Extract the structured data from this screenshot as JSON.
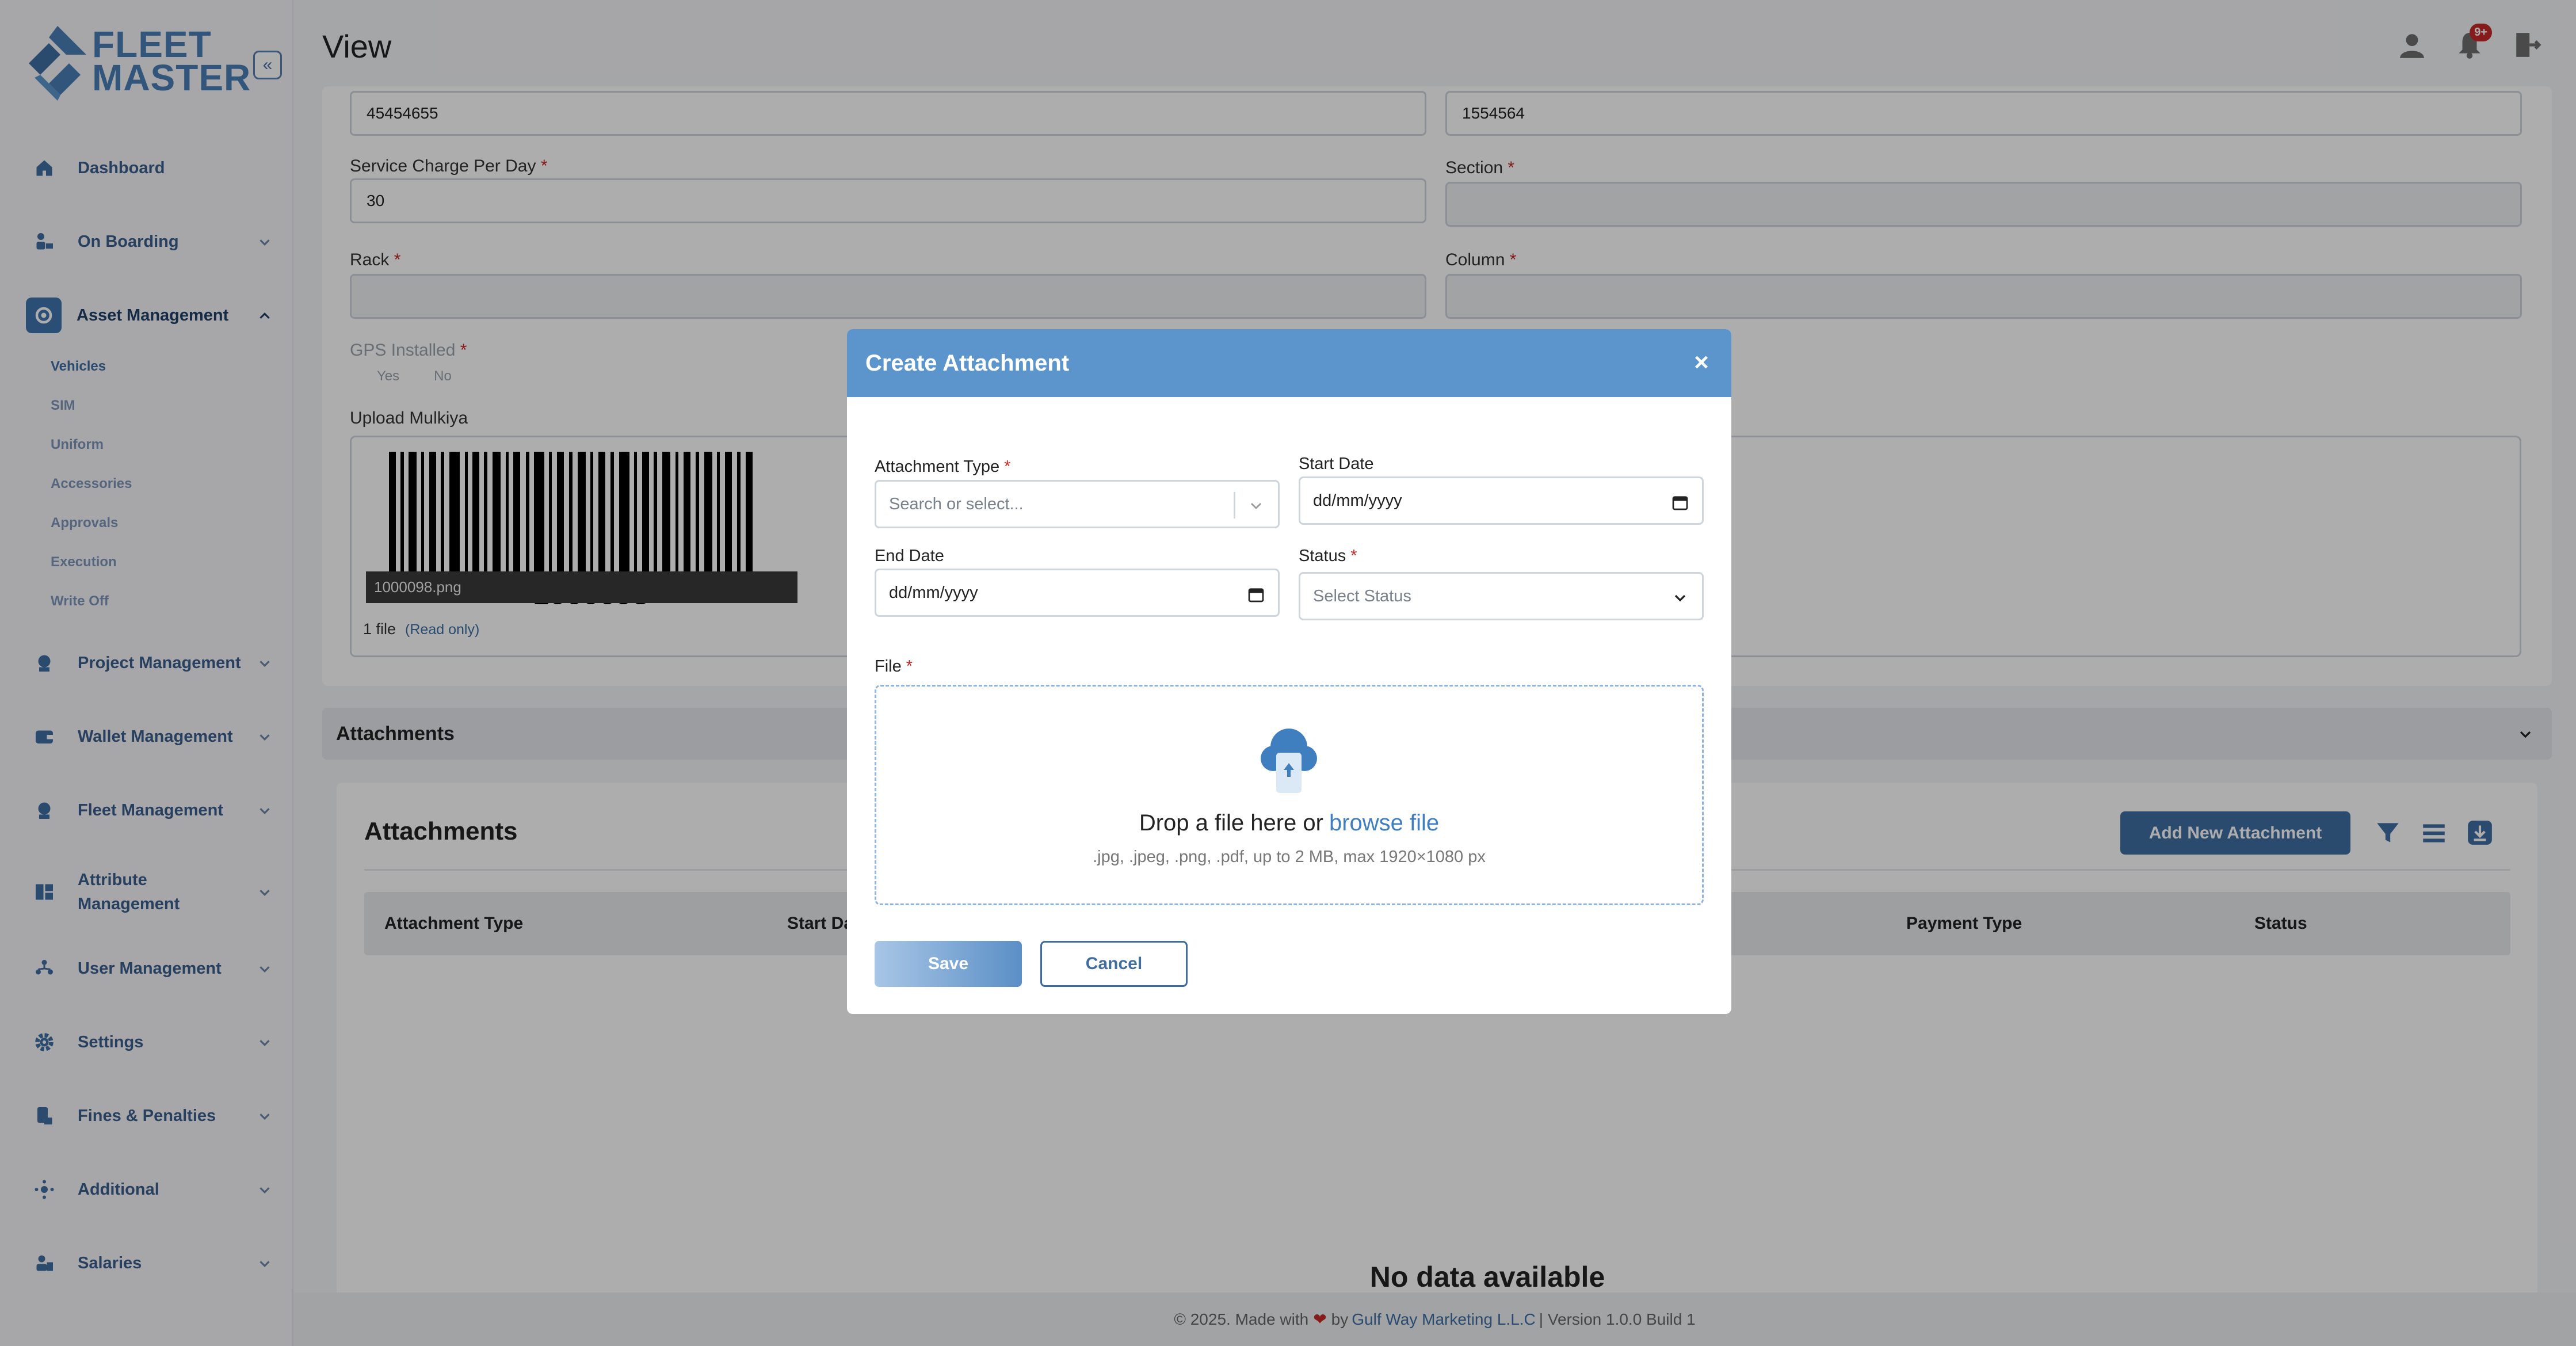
{
  "brand": {
    "line1": "FLEET",
    "line2": "MASTER"
  },
  "page": {
    "title": "View"
  },
  "notifications": {
    "badge": "9+"
  },
  "sidebar": {
    "items": [
      {
        "label": "Dashboard",
        "icon": "home-icon"
      },
      {
        "label": "On Boarding",
        "icon": "onboarding-icon"
      },
      {
        "label": "Asset Management",
        "icon": "asset-icon"
      },
      {
        "label": "Project Management",
        "icon": "project-icon"
      },
      {
        "label": "Wallet Management",
        "icon": "wallet-icon"
      },
      {
        "label": "Fleet Management",
        "icon": "fleet-icon"
      },
      {
        "label": "Attribute Management",
        "icon": "attribute-icon"
      },
      {
        "label": "User Management",
        "icon": "users-icon"
      },
      {
        "label": "Settings",
        "icon": "gear-icon"
      },
      {
        "label": "Fines & Penalties",
        "icon": "fines-icon"
      },
      {
        "label": "Additional",
        "icon": "additional-icon"
      },
      {
        "label": "Salaries",
        "icon": "salaries-icon"
      }
    ],
    "sub_items": [
      "Vehicles",
      "SIM",
      "Uniform",
      "Accessories",
      "Approvals",
      "Execution",
      "Write Off"
    ]
  },
  "form": {
    "field1_value": "45454655",
    "field2_value": "1554564",
    "service_charge_label": "Service Charge Per Day",
    "service_charge_value": "30",
    "section_label": "Section",
    "rack_label": "Rack",
    "column_label": "Column",
    "gps_label": "GPS Installed",
    "gps_yes": "Yes",
    "gps_no": "No",
    "upload_label": "Upload Mulkiya",
    "file_name": "1000098.png",
    "barcode_number": "1000098",
    "file_count": "1 file",
    "read_only": "(Read only)"
  },
  "accordion": {
    "title": "Attachments"
  },
  "attachments": {
    "title": "Attachments",
    "add_button": "Add New Attachment",
    "columns": [
      "Attachment Type",
      "Start Da",
      "Payment Type",
      "Status"
    ],
    "empty": "No data available"
  },
  "footer": {
    "prefix": "© 2025. Made with",
    "by": "by",
    "company": "Gulf Way Marketing L.L.C",
    "version": "| Version 1.0.0 Build 1"
  },
  "modal": {
    "title": "Create Attachment",
    "attachment_type_label": "Attachment Type",
    "attachment_type_placeholder": "Search or select...",
    "start_date_label": "Start Date",
    "start_date_value": "dd/mm/yyyy",
    "end_date_label": "End Date",
    "end_date_value": "dd/mm/yyyy",
    "status_label": "Status",
    "status_placeholder": "Select Status",
    "file_label": "File",
    "drop_text": "Drop a file here or",
    "browse_text": "browse file",
    "hint": ".jpg, .jpeg, .png, .pdf, up to 2 MB, max 1920×1080 px",
    "save": "Save",
    "cancel": "Cancel"
  },
  "colors": {
    "accent": "#3f6da3",
    "header": "#5b95cc",
    "required": "#c62828"
  }
}
